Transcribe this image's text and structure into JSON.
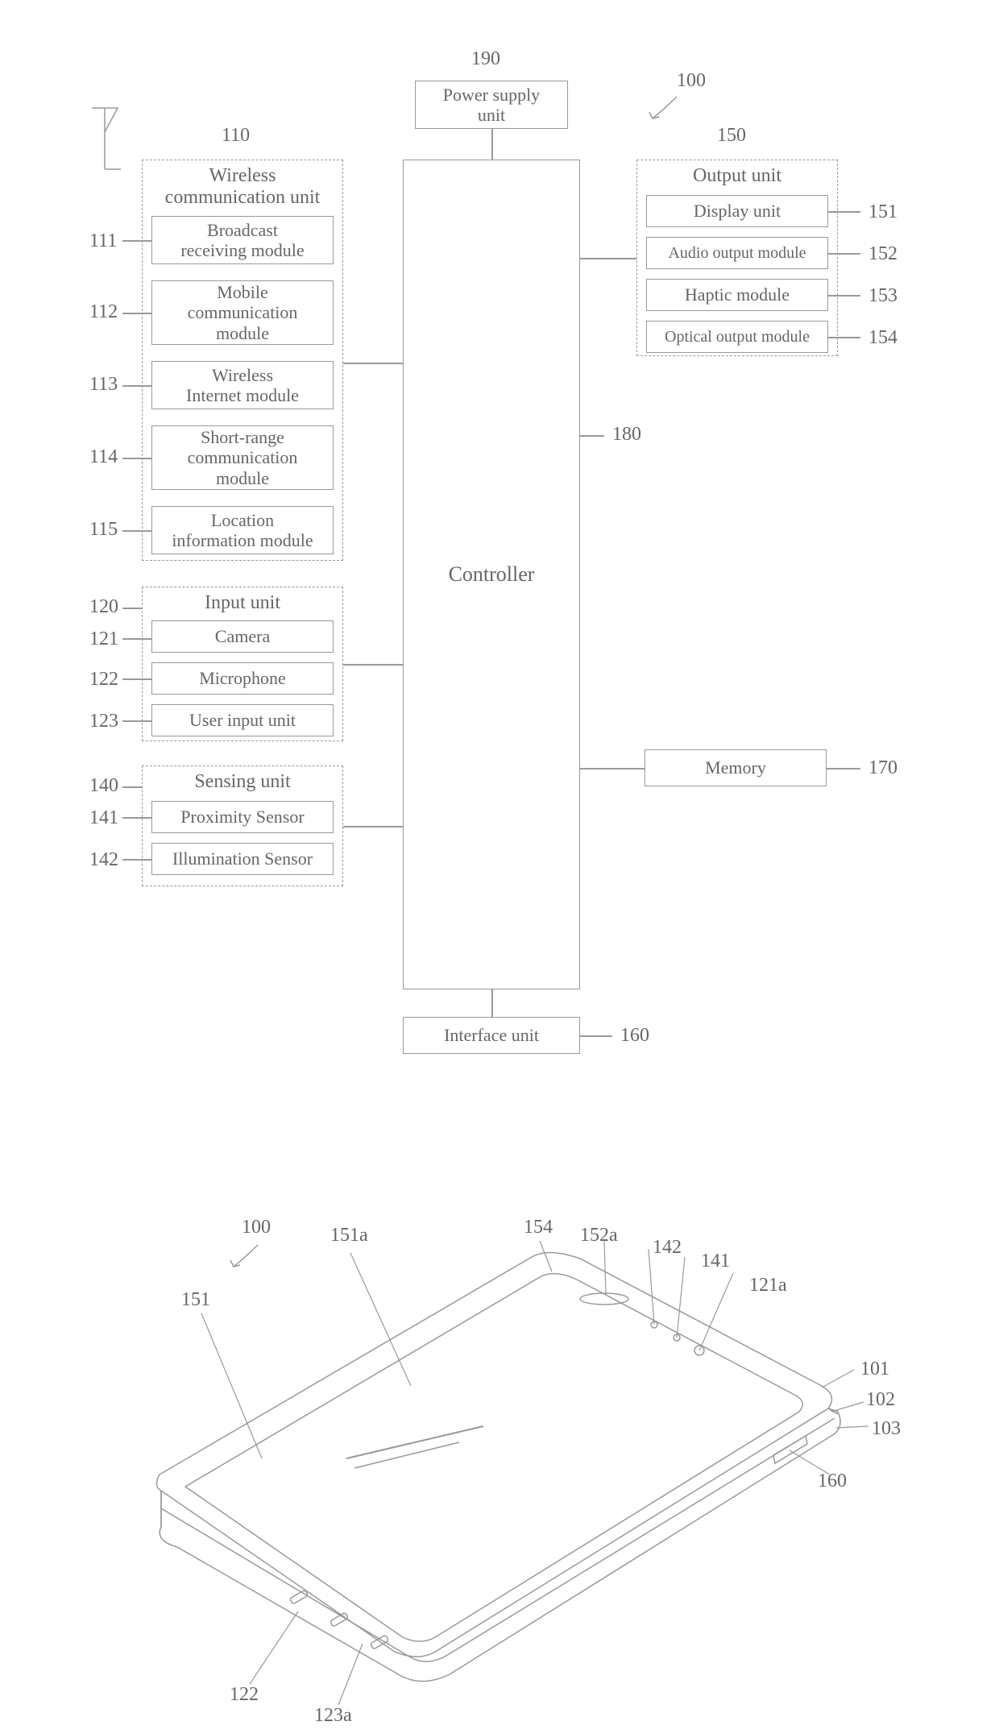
{
  "refs": {
    "r100": "100",
    "r110": "110",
    "r111": "111",
    "r112": "112",
    "r113": "113",
    "r114": "114",
    "r115": "115",
    "r120": "120",
    "r121": "121",
    "r122": "122",
    "r123": "123",
    "r140": "140",
    "r141": "141",
    "r142": "142",
    "r150": "150",
    "r151": "151",
    "r152": "152",
    "r153": "153",
    "r154": "154",
    "r160": "160",
    "r170": "170",
    "r180": "180",
    "r190": "190"
  },
  "blocks": {
    "power_supply": "Power supply\nunit",
    "controller": "Controller",
    "wireless_unit": "Wireless\ncommunication unit",
    "broadcast": "Broadcast\nreceiving module",
    "mobile_comm": "Mobile\ncommunication\nmodule",
    "wireless_internet": "Wireless\nInternet module",
    "short_range": "Short-range\ncommunication\nmodule",
    "location": "Location\ninformation module",
    "input_unit": "Input unit",
    "camera": "Camera",
    "microphone": "Microphone",
    "user_input": "User input unit",
    "sensing_unit": "Sensing unit",
    "proximity": "Proximity Sensor",
    "illumination": "Illumination Sensor",
    "output_unit": "Output unit",
    "display": "Display unit",
    "audio_out": "Audio output module",
    "haptic": "Haptic module",
    "optical_out": "Optical output module",
    "memory": "Memory",
    "interface": "Interface unit"
  },
  "perspective_refs": {
    "p100": "100",
    "p151a": "151a",
    "p154": "154",
    "p152a": "152a",
    "p142": "142",
    "p141": "141",
    "p121a": "121a",
    "p101": "101",
    "p102": "102",
    "p103": "103",
    "p160": "160",
    "p151": "151",
    "p122": "122",
    "p123a": "123a"
  }
}
